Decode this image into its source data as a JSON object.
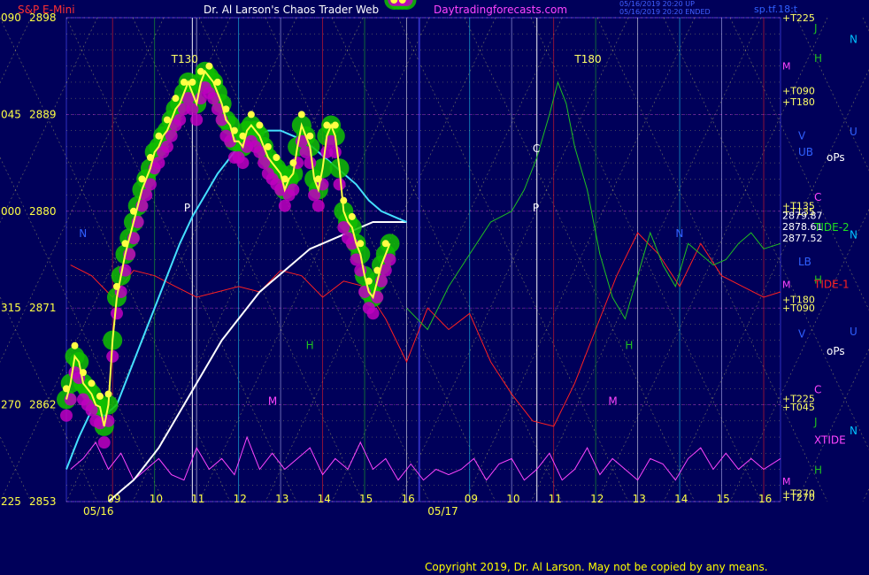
{
  "header": {
    "product": "S&P E-Mini",
    "title": "Dr. Al Larson's Chaos Trader Web",
    "site": "Daytradingforecasts.com",
    "timestamp_line1": "05/16/2019 20:20 UP",
    "timestamp_line2": "05/16/2019 20:20 ENDED",
    "symbol": "sp.tf.18:t"
  },
  "footer": {
    "copyright": "Copyright 2019, Dr. Al Larson. May not be copied by any means."
  },
  "colors": {
    "background": "#00005a",
    "price": "#ffff44",
    "flux_high": "#10c000",
    "flux_low": "#c000c0",
    "ema_fast": "#44e0ff",
    "ema_slow": "#ffffff",
    "tide": "#ff2020",
    "xtide": "#ff44ff",
    "grid_yellow": "#ffff66",
    "session_split": "#3030c0"
  },
  "chart_data": {
    "type": "line",
    "title": "S&P E-Mini",
    "ylim": [
      2853,
      2898
    ],
    "y_ticks": [
      {
        "left": "090",
        "value": 2898
      },
      {
        "left": "045",
        "value": 2889
      },
      {
        "left": "000",
        "value": 2880
      },
      {
        "left": "315",
        "value": 2871
      },
      {
        "left": "270",
        "value": 2862
      },
      {
        "left": "225",
        "value": 2853
      }
    ],
    "x_ticks": [
      {
        "label": "09",
        "x": 9
      },
      {
        "label": "10",
        "x": 10
      },
      {
        "label": "11",
        "x": 11
      },
      {
        "label": "12",
        "x": 12
      },
      {
        "label": "13",
        "x": 13
      },
      {
        "label": "14",
        "x": 14
      },
      {
        "label": "15",
        "x": 15
      },
      {
        "label": "16",
        "x": 16
      },
      {
        "label": "09",
        "x": 17.5
      },
      {
        "label": "10",
        "x": 18.5
      },
      {
        "label": "11",
        "x": 19.5
      },
      {
        "label": "12",
        "x": 20.5
      },
      {
        "label": "13",
        "x": 21.5
      },
      {
        "label": "14",
        "x": 22.5
      },
      {
        "label": "15",
        "x": 23.5
      },
      {
        "label": "16",
        "x": 24.5
      }
    ],
    "x_range": [
      7.9,
      24.9
    ],
    "date_labels": [
      {
        "label": "05/16",
        "x": 8.3
      },
      {
        "label": "05/17",
        "x": 16.5
      }
    ],
    "price": {
      "x": [
        7.9,
        8.0,
        8.1,
        8.2,
        8.3,
        8.4,
        8.5,
        8.6,
        8.7,
        8.8,
        8.9,
        9.0,
        9.1,
        9.2,
        9.3,
        9.4,
        9.5,
        9.6,
        9.7,
        9.8,
        9.9,
        10.0,
        10.1,
        10.2,
        10.3,
        10.4,
        10.5,
        10.6,
        10.7,
        10.8,
        10.9,
        11.0,
        11.1,
        11.2,
        11.3,
        11.4,
        11.5,
        11.6,
        11.7,
        11.8,
        11.9,
        12.0,
        12.1,
        12.2,
        12.3,
        12.4,
        12.5,
        12.6,
        12.7,
        12.8,
        12.9,
        13.0,
        13.1,
        13.2,
        13.3,
        13.4,
        13.5,
        13.6,
        13.7,
        13.8,
        13.9,
        14.0,
        14.1,
        14.2,
        14.3,
        14.4,
        14.5,
        14.6,
        14.7,
        14.8,
        14.9,
        15.0,
        15.1,
        15.2,
        15.3,
        15.4,
        15.5,
        15.6,
        15.7,
        15.8,
        15.9,
        16.0
      ],
      "y": [
        2862.5,
        2864,
        2866.5,
        2866,
        2864,
        2863.5,
        2863,
        2862,
        2861.8,
        2860,
        2862,
        2868,
        2872,
        2874,
        2876,
        2877.5,
        2879,
        2880.5,
        2882,
        2883,
        2884,
        2885.5,
        2886,
        2887,
        2887.5,
        2888.5,
        2889.5,
        2890,
        2891,
        2892,
        2891,
        2890,
        2892,
        2893,
        2892.5,
        2892,
        2891,
        2890,
        2888.5,
        2888,
        2886.5,
        2886.5,
        2886,
        2887.5,
        2888,
        2887.5,
        2887,
        2886,
        2885,
        2884.5,
        2884,
        2883.5,
        2882,
        2883,
        2883.5,
        2886,
        2888,
        2887,
        2886,
        2883,
        2882,
        2884,
        2887,
        2888,
        2887,
        2884,
        2880,
        2879,
        2878.5,
        2877,
        2876,
        2874,
        2872.5,
        2872,
        2873.5,
        2875,
        2876,
        2877
      ]
    },
    "price_projection": {
      "x": [
        16.0,
        16.5,
        17.0,
        17.5,
        18.0,
        18.5,
        18.8,
        19.1,
        19.4,
        19.6,
        19.8,
        20.0,
        20.3,
        20.6,
        20.9,
        21.2,
        21.5,
        21.8,
        22.1,
        22.4,
        22.7,
        23.0,
        23.3,
        23.6,
        23.9,
        24.2,
        24.5,
        24.9
      ],
      "y": [
        2871,
        2869,
        2873,
        2876,
        2879,
        2880,
        2882,
        2885,
        2889,
        2892,
        2890,
        2886,
        2882,
        2876,
        2872,
        2870,
        2874,
        2878,
        2875,
        2873,
        2877,
        2876,
        2875,
        2875.5,
        2877,
        2878,
        2876.5,
        2877
      ]
    },
    "ema_fast": {
      "x": [
        7.9,
        8.2,
        8.5,
        8.8,
        9.1,
        9.4,
        9.7,
        10.0,
        10.3,
        10.6,
        10.9,
        11.2,
        11.5,
        11.8,
        12.1,
        12.4,
        12.7,
        13.0,
        13.3,
        13.6,
        13.9,
        14.2,
        14.5,
        14.8,
        15.1,
        15.4,
        15.7,
        16.0
      ],
      "y": [
        2856,
        2859,
        2861.5,
        2861,
        2862,
        2865,
        2868,
        2871,
        2874,
        2877,
        2879.5,
        2881.5,
        2883.5,
        2885,
        2886.5,
        2887,
        2887.5,
        2887.5,
        2887,
        2886.5,
        2885.5,
        2884.5,
        2883.5,
        2882.5,
        2881,
        2880,
        2879.5,
        2879
      ]
    },
    "ema_slow": {
      "x": [
        8.9,
        9.2,
        9.5,
        9.8,
        10.1,
        10.4,
        10.7,
        11.0,
        11.3,
        11.6,
        11.9,
        12.2,
        12.5,
        12.8,
        13.1,
        13.4,
        13.7,
        14.0,
        14.3,
        14.6,
        14.9,
        15.2,
        15.5,
        15.8,
        16.0
      ],
      "y": [
        2853,
        2854,
        2855,
        2856.5,
        2858,
        2860,
        2862,
        2864,
        2866,
        2868,
        2869.5,
        2871,
        2872.5,
        2873.5,
        2874.5,
        2875.5,
        2876.5,
        2877,
        2877.5,
        2878,
        2878.5,
        2879,
        2879,
        2879,
        2879
      ]
    },
    "tide_1": {
      "x": [
        8.0,
        8.5,
        9.0,
        9.5,
        10.0,
        10.5,
        11.0,
        11.5,
        12.0,
        12.5,
        13.0,
        13.5,
        14.0,
        14.5,
        15.0,
        15.5,
        16.0,
        16.5,
        17.0,
        17.5,
        18.0,
        18.5,
        19.0,
        19.5,
        20.0,
        20.5,
        21.0,
        21.5,
        22.0,
        22.5,
        23.0,
        23.5,
        24.0,
        24.5,
        24.9
      ],
      "y": [
        2875,
        2874,
        2872,
        2874.5,
        2874,
        2873,
        2872,
        2872.5,
        2873,
        2872.5,
        2874.5,
        2874,
        2872,
        2873.5,
        2873,
        2870,
        2866,
        2871,
        2869,
        2870.5,
        2866,
        2863,
        2860.5,
        2860,
        2864,
        2869,
        2874,
        2878,
        2876,
        2873,
        2877,
        2874,
        2873,
        2872,
        2872.5
      ]
    },
    "flux_oscillator": {
      "x": [
        8.0,
        8.3,
        8.6,
        8.9,
        9.2,
        9.5,
        9.8,
        10.1,
        10.4,
        10.7,
        11.0,
        11.3,
        11.6,
        11.9,
        12.2,
        12.5,
        12.8,
        13.1,
        13.4,
        13.7,
        14.0,
        14.3,
        14.6,
        14.9,
        15.2,
        15.5,
        15.8,
        16.1,
        16.4,
        16.7,
        17.0,
        17.3,
        17.6,
        17.9,
        18.2,
        18.5,
        18.8,
        19.1,
        19.4,
        19.7,
        20.0,
        20.3,
        20.6,
        20.9,
        21.2,
        21.5,
        21.8,
        22.1,
        22.4,
        22.7,
        23.0,
        23.3,
        23.6,
        23.9,
        24.2,
        24.5,
        24.9
      ],
      "y": [
        2856,
        2857,
        2858.5,
        2856,
        2857.5,
        2855,
        2856,
        2857,
        2855.5,
        2855,
        2858,
        2856,
        2857,
        2855.5,
        2859,
        2856,
        2857.5,
        2856,
        2857,
        2858,
        2855.5,
        2857,
        2856,
        2858.5,
        2856,
        2857,
        2855,
        2856.5,
        2855,
        2856,
        2855.5,
        2856,
        2857,
        2855,
        2856.5,
        2857,
        2855,
        2856,
        2857.5,
        2855,
        2856,
        2858,
        2855.5,
        2857,
        2856,
        2855,
        2857,
        2856.5,
        2855,
        2857,
        2858,
        2856,
        2857.5,
        2856,
        2857,
        2856,
        2857
      ]
    },
    "right_labels": [
      {
        "text": "+T225",
        "value": 2898,
        "color": "#ffff66"
      },
      {
        "text": "M",
        "value": 2893.5,
        "color": "#ff44ff"
      },
      {
        "text": "+T090",
        "value": 2891.2,
        "color": "#ffff66"
      },
      {
        "text": "+T180",
        "value": 2890.2,
        "color": "#ffff66"
      },
      {
        "text": "+T135",
        "value": 2880.5,
        "color": "#ffff66"
      },
      {
        "text": "+T135",
        "value": 2880.0,
        "color": "#ffff66"
      },
      {
        "text": "2879.87",
        "value": 2879.6,
        "color": "#ffffff"
      },
      {
        "text": "2878.61",
        "value": 2878.6,
        "color": "#ffffff"
      },
      {
        "text": "2877.52",
        "value": 2877.5,
        "color": "#ffffff"
      },
      {
        "text": "M",
        "value": 2873.2,
        "color": "#ff44ff"
      },
      {
        "text": "+T180",
        "value": 2871.8,
        "color": "#ffff66"
      },
      {
        "text": "+T090",
        "value": 2871.0,
        "color": "#ffff66"
      },
      {
        "text": "+T225",
        "value": 2862.6,
        "color": "#ffff66"
      },
      {
        "text": "+T045",
        "value": 2861.8,
        "color": "#ffff66"
      },
      {
        "text": "M",
        "value": 2854.9,
        "color": "#ff44ff"
      },
      {
        "text": "+T270",
        "value": 2853.8,
        "color": "#ffff66"
      },
      {
        "text": "+T270",
        "value": 2853.4,
        "color": "#ffff66"
      }
    ],
    "side_labels": [
      {
        "text": "J",
        "value": 2897,
        "col": 1,
        "color": "#20c020"
      },
      {
        "text": "N",
        "value": 2896,
        "col": 3,
        "color": "#00c0ff"
      },
      {
        "text": "H",
        "value": 2894.2,
        "col": 1,
        "color": "#20c020"
      },
      {
        "text": "V",
        "value": 2887,
        "col": 0,
        "color": "#3060ff"
      },
      {
        "text": "U",
        "value": 2887.4,
        "col": 3,
        "color": "#3060ff"
      },
      {
        "text": "UB",
        "value": 2885.5,
        "col": 0,
        "color": "#3060ff"
      },
      {
        "text": "oPs",
        "value": 2885,
        "col": 2,
        "color": "#ffffff"
      },
      {
        "text": "C",
        "value": 2881.3,
        "col": 1,
        "color": "#ff44ff"
      },
      {
        "text": "TIDE-2",
        "value": 2878.5,
        "col": 1,
        "color": "#20e020"
      },
      {
        "text": "N",
        "value": 2877.8,
        "col": 3,
        "color": "#00c0ff"
      },
      {
        "text": "LB",
        "value": 2875.3,
        "col": 0,
        "color": "#3060ff"
      },
      {
        "text": "H",
        "value": 2873.6,
        "col": 1,
        "color": "#20c020"
      },
      {
        "text": "TIDE-1",
        "value": 2873.2,
        "col": 1,
        "color": "#ff2020"
      },
      {
        "text": "V",
        "value": 2868.6,
        "col": 0,
        "color": "#3060ff"
      },
      {
        "text": "U",
        "value": 2868.8,
        "col": 3,
        "color": "#3060ff"
      },
      {
        "text": "oPs",
        "value": 2867,
        "col": 2,
        "color": "#ffffff"
      },
      {
        "text": "C",
        "value": 2863.4,
        "col": 1,
        "color": "#ff44ff"
      },
      {
        "text": "J",
        "value": 2860.4,
        "col": 1,
        "color": "#20c020"
      },
      {
        "text": "N",
        "value": 2859.6,
        "col": 3,
        "color": "#00c0ff"
      },
      {
        "text": "XTIDE",
        "value": 2858.7,
        "col": 1,
        "color": "#ff44ff"
      },
      {
        "text": "H",
        "value": 2855.9,
        "col": 1,
        "color": "#20c020"
      }
    ],
    "in_chart_labels": [
      {
        "text": "T130",
        "x": 10.4,
        "value": 2893.8,
        "color": "#ffff66"
      },
      {
        "text": "T180",
        "x": 20.0,
        "value": 2893.8,
        "color": "#ffff66"
      },
      {
        "text": "N",
        "x": 8.2,
        "value": 2877.6,
        "color": "#3060ff"
      },
      {
        "text": "P",
        "x": 10.7,
        "value": 2880,
        "color": "#ffffff"
      },
      {
        "text": "P",
        "x": 19.0,
        "value": 2880,
        "color": "#ffffff"
      },
      {
        "text": "C",
        "x": 19.0,
        "value": 2885.5,
        "color": "#ffffff"
      },
      {
        "text": "N",
        "x": 22.4,
        "value": 2877.6,
        "color": "#3060ff"
      },
      {
        "text": "M",
        "x": 12.7,
        "value": 2862,
        "color": "#ff44ff"
      },
      {
        "text": "M",
        "x": 20.8,
        "value": 2862,
        "color": "#ff44ff"
      },
      {
        "text": "H",
        "x": 13.6,
        "value": 2867.2,
        "color": "#20c020"
      },
      {
        "text": "H",
        "x": 21.2,
        "value": 2867.2,
        "color": "#20c020"
      }
    ]
  }
}
